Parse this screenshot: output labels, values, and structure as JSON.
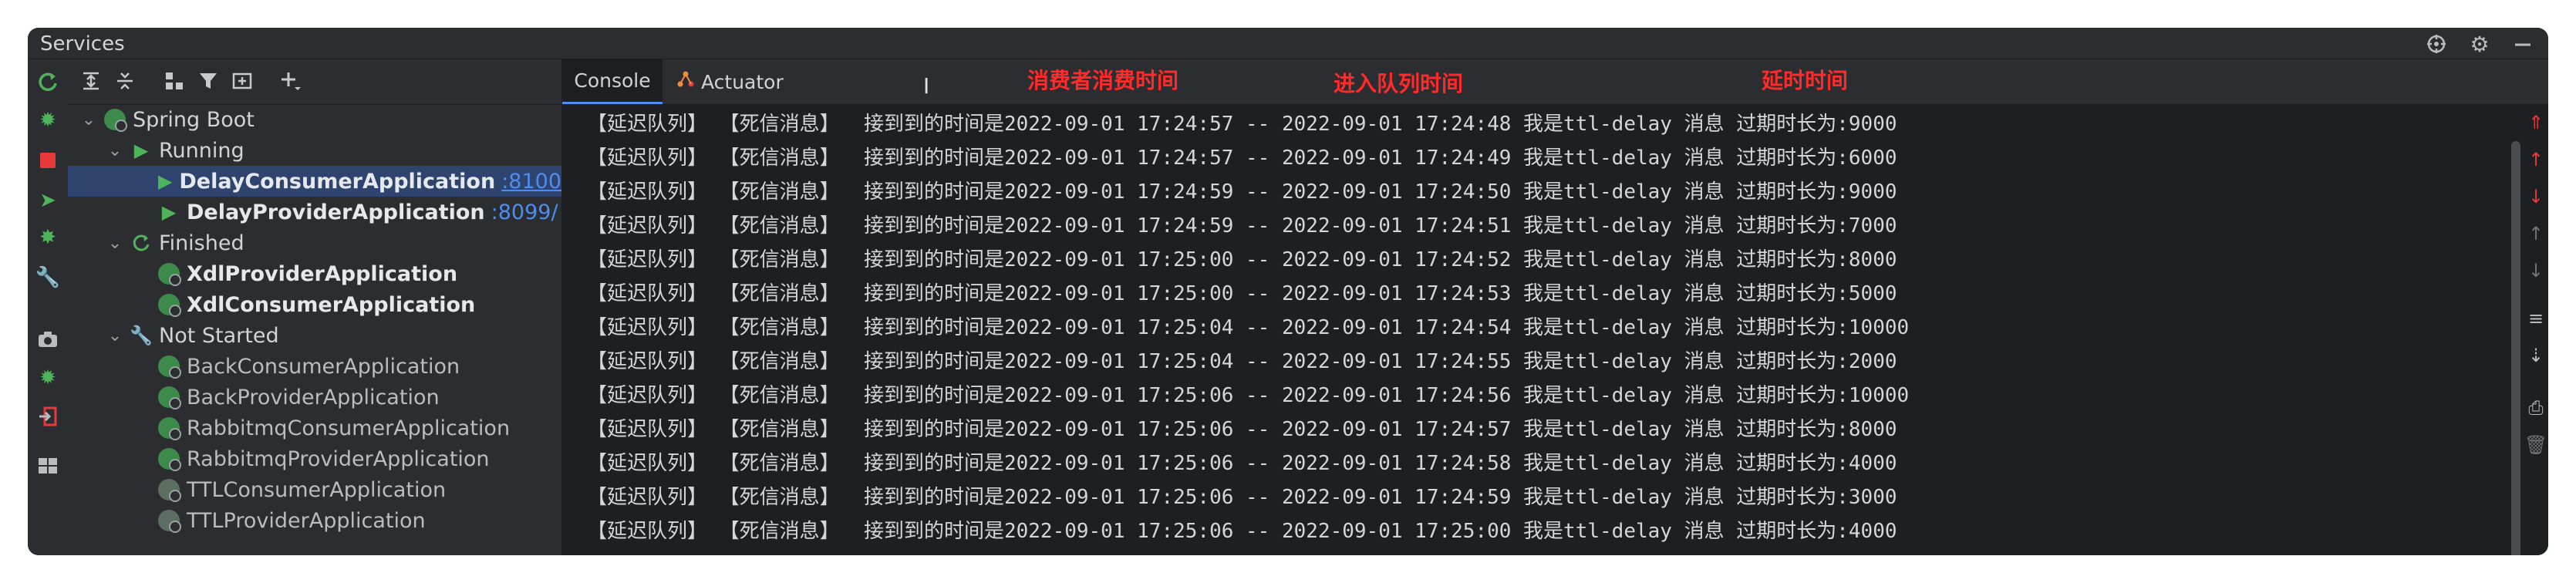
{
  "window": {
    "title": "Services"
  },
  "toolbar_icons": [
    "refresh-icon",
    "expand-all-icon",
    "collapse-all-icon",
    "group-by-icon",
    "filter-icon",
    "new-tab-icon",
    "add-icon"
  ],
  "tree": {
    "root": {
      "label": "Spring Boot"
    },
    "running": {
      "label": "Running",
      "items": [
        {
          "name": "DelayConsumerApplication",
          "port": ":8100"
        },
        {
          "name": "DelayProviderApplication",
          "port": ":8099/"
        }
      ]
    },
    "finished": {
      "label": "Finished",
      "items": [
        {
          "name": "XdlProviderApplication"
        },
        {
          "name": "XdlConsumerApplication"
        }
      ]
    },
    "not_started": {
      "label": "Not Started",
      "items": [
        {
          "name": "BackConsumerApplication"
        },
        {
          "name": "BackProviderApplication"
        },
        {
          "name": "RabbitmqConsumerApplication"
        },
        {
          "name": "RabbitmqProviderApplication"
        },
        {
          "name": "TTLConsumerApplication"
        },
        {
          "name": "TTLProviderApplication"
        }
      ]
    }
  },
  "tabs": [
    {
      "label": "Console"
    },
    {
      "label": "Actuator"
    }
  ],
  "annotations": {
    "consume_time": "消费者消费时间",
    "enqueue_time": "进入队列时间",
    "delay_time": "延时时间"
  },
  "console_lines": [
    "【延迟队列】 【死信消息】  接到到的时间是2022-09-01 17:24:57 -- 2022-09-01 17:24:48 我是ttl-delay 消息 过期时长为:9000",
    "【延迟队列】 【死信消息】  接到到的时间是2022-09-01 17:24:57 -- 2022-09-01 17:24:49 我是ttl-delay 消息 过期时长为:6000",
    "【延迟队列】 【死信消息】  接到到的时间是2022-09-01 17:24:59 -- 2022-09-01 17:24:50 我是ttl-delay 消息 过期时长为:9000",
    "【延迟队列】 【死信消息】  接到到的时间是2022-09-01 17:24:59 -- 2022-09-01 17:24:51 我是ttl-delay 消息 过期时长为:7000",
    "【延迟队列】 【死信消息】  接到到的时间是2022-09-01 17:25:00 -- 2022-09-01 17:24:52 我是ttl-delay 消息 过期时长为:8000",
    "【延迟队列】 【死信消息】  接到到的时间是2022-09-01 17:25:00 -- 2022-09-01 17:24:53 我是ttl-delay 消息 过期时长为:5000",
    "【延迟队列】 【死信消息】  接到到的时间是2022-09-01 17:25:04 -- 2022-09-01 17:24:54 我是ttl-delay 消息 过期时长为:10000",
    "【延迟队列】 【死信消息】  接到到的时间是2022-09-01 17:25:04 -- 2022-09-01 17:24:55 我是ttl-delay 消息 过期时长为:2000",
    "【延迟队列】 【死信消息】  接到到的时间是2022-09-01 17:25:06 -- 2022-09-01 17:24:56 我是ttl-delay 消息 过期时长为:10000",
    "【延迟队列】 【死信消息】  接到到的时间是2022-09-01 17:25:06 -- 2022-09-01 17:24:57 我是ttl-delay 消息 过期时长为:8000",
    "【延迟队列】 【死信消息】  接到到的时间是2022-09-01 17:25:06 -- 2022-09-01 17:24:58 我是ttl-delay 消息 过期时长为:4000",
    "【延迟队列】 【死信消息】  接到到的时间是2022-09-01 17:25:06 -- 2022-09-01 17:24:59 我是ttl-delay 消息 过期时长为:3000",
    "【延迟队列】 【死信消息】  接到到的时间是2022-09-01 17:25:06 -- 2022-09-01 17:25:00 我是ttl-delay 消息 过期时长为:4000"
  ],
  "colors": {
    "accent": "#4e8df0",
    "annotation": "#ff2a2a",
    "run_green": "#4fb35b",
    "stop_red": "#e5393a"
  }
}
